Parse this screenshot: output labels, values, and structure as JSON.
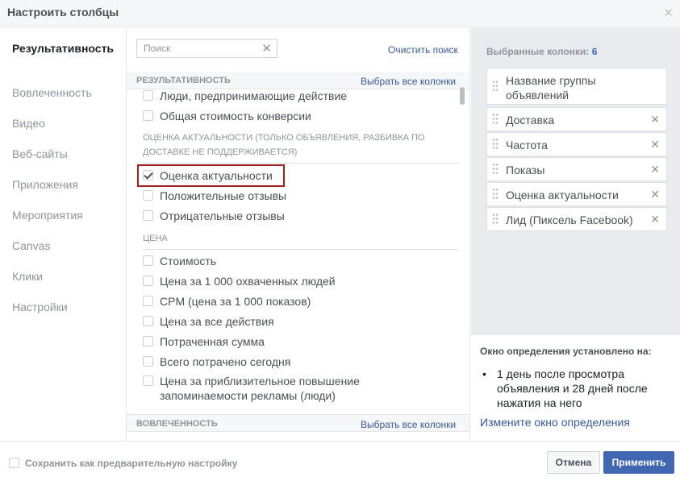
{
  "dialog": {
    "title": "Настроить столбцы"
  },
  "sidebar": {
    "items": [
      {
        "label": "Результативность"
      },
      {
        "label": "Вовлеченность"
      },
      {
        "label": "Видео"
      },
      {
        "label": "Веб-сайты"
      },
      {
        "label": "Приложения"
      },
      {
        "label": "Мероприятия"
      },
      {
        "label": "Canvas"
      },
      {
        "label": "Клики"
      },
      {
        "label": "Настройки"
      }
    ],
    "active": "Результативность"
  },
  "search": {
    "placeholder": "Поиск",
    "value": "",
    "clear_label": "Очистить поиск"
  },
  "sections": {
    "performance": {
      "title": "РЕЗУЛЬТАТИВНОСТЬ",
      "select_all": "Выбрать все колонки",
      "items": [
        {
          "label": "Люди, предпринимающие действие",
          "checked": false
        },
        {
          "label": "Общая стоимость конверсии",
          "checked": false
        }
      ],
      "relevance": {
        "heading": "ОЦЕНКА АКТУАЛЬНОСТИ (ТОЛЬКО ОБЪЯВЛЕНИЯ, РАЗБИВКА ПО ДОСТАВКЕ НЕ ПОДДЕРЖИВАЕТСЯ)",
        "items": [
          {
            "label": "Оценка актуальности",
            "checked": true
          },
          {
            "label": "Положительные отзывы",
            "checked": false
          },
          {
            "label": "Отрицательные отзывы",
            "checked": false
          }
        ]
      },
      "price": {
        "heading": "ЦЕНА",
        "items": [
          {
            "label": "Стоимость",
            "checked": false
          },
          {
            "label": "Цена за 1 000 охваченных людей",
            "checked": false
          },
          {
            "label": "CPM (цена за 1 000 показов)",
            "checked": false
          },
          {
            "label": "Цена за все действия",
            "checked": false
          },
          {
            "label": "Потраченная сумма",
            "checked": false
          },
          {
            "label": "Всего потрачено сегодня",
            "checked": false
          },
          {
            "label": "Цена за приблизительное повышение запоминаемости рекламы (люди)",
            "checked": false
          }
        ]
      }
    },
    "engagement": {
      "title": "ВОВЛЕЧЕННОСТЬ",
      "select_all": "Выбрать все колонки"
    }
  },
  "selected": {
    "title": "Выбранные колонки:",
    "count": "6",
    "items": [
      {
        "label": "Название группы объявлений"
      },
      {
        "label": "Доставка"
      },
      {
        "label": "Частота"
      },
      {
        "label": "Показы"
      },
      {
        "label": "Оценка актуальности"
      },
      {
        "label": "Лид (Пиксель Facebook)"
      }
    ]
  },
  "attribution": {
    "title": "Окно определения установлено на:",
    "items": [
      "1 день после просмотра объявления и 28 дней после нажатия на него"
    ],
    "change_link": "Измените окно определения"
  },
  "footer": {
    "save_preset": "Сохранить как предварительную настройку",
    "cancel": "Отмена",
    "apply": "Применить"
  },
  "colors": {
    "accent": "#4267b2",
    "link": "#365899",
    "highlight": "#a31f1f"
  }
}
